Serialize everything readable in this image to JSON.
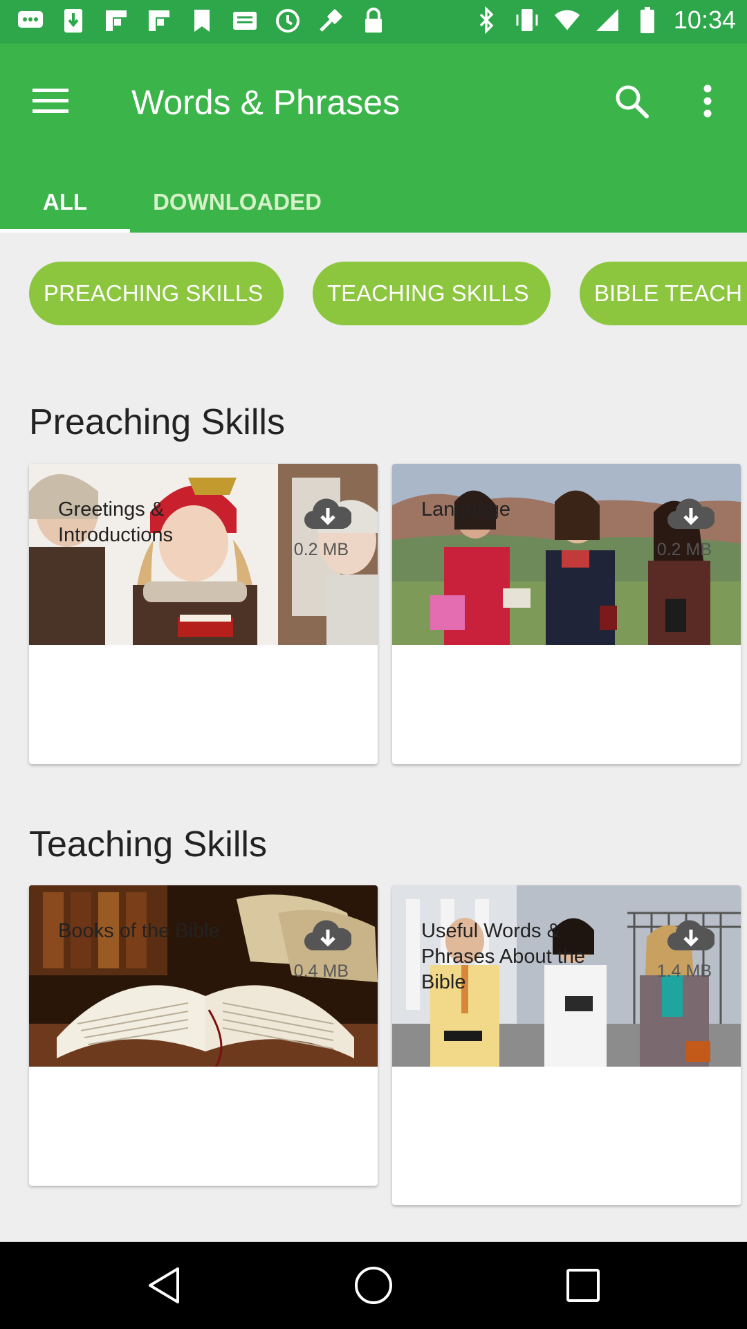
{
  "status_bar": {
    "time": "10:34",
    "left_icons": [
      "messages-icon",
      "download-icon",
      "flipboard-icon",
      "flipboard-icon",
      "bookmark-icon",
      "mail-icon",
      "sync-icon",
      "fake-gps-icon",
      "lock-icon"
    ],
    "right_icons": [
      "bluetooth-icon",
      "vibrate-icon",
      "wifi-icon",
      "signal-icon",
      "battery-icon"
    ]
  },
  "app_bar": {
    "title": "Words & Phrases",
    "menu_icon": "hamburger-menu-icon",
    "search_icon": "search-icon",
    "more_icon": "more-vert-icon",
    "color": "#3bb54a"
  },
  "tabs": [
    {
      "label": "ALL",
      "selected": true
    },
    {
      "label": "DOWNLOADED",
      "selected": false
    }
  ],
  "chips": [
    {
      "label": "PREACHING SKILLS"
    },
    {
      "label": "TEACHING SKILLS"
    },
    {
      "label": "BIBLE TEACH"
    }
  ],
  "sections": [
    {
      "title": "Preaching Skills",
      "items": [
        {
          "name": "Greetings & Introductions",
          "size": "0.2 MB"
        },
        {
          "name": "Language",
          "size": "0.2 MB"
        }
      ]
    },
    {
      "title": "Teaching Skills",
      "items": [
        {
          "name": "Books of the Bible",
          "size": "0.4 MB"
        },
        {
          "name": "Useful Words & Phrases About the Bible",
          "size": "1.4 MB"
        }
      ]
    }
  ],
  "colors": {
    "chip": "#8cc63f",
    "statusbar": "#2ea64a"
  }
}
